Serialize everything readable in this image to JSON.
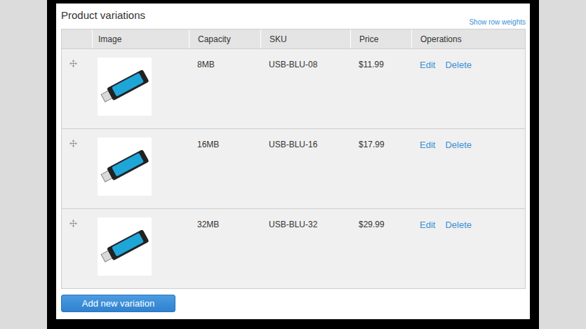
{
  "section": {
    "title": "Product variations",
    "link": "Show row weights"
  },
  "table": {
    "columns": [
      "Image",
      "Capacity",
      "SKU",
      "Price",
      "Operations"
    ],
    "rows": [
      {
        "capacity": "8MB",
        "sku": "USB-BLU-08",
        "price": "$11.99",
        "operations": [
          "Edit",
          "Delete"
        ]
      },
      {
        "capacity": "16MB",
        "sku": "USB-BLU-16",
        "price": "$17.99",
        "operations": [
          "Edit",
          "Delete"
        ]
      },
      {
        "capacity": "32MB",
        "sku": "USB-BLU-32",
        "price": "$29.99",
        "operations": [
          "Edit",
          "Delete"
        ]
      }
    ]
  },
  "buttons": [
    "Add new variation"
  ]
}
